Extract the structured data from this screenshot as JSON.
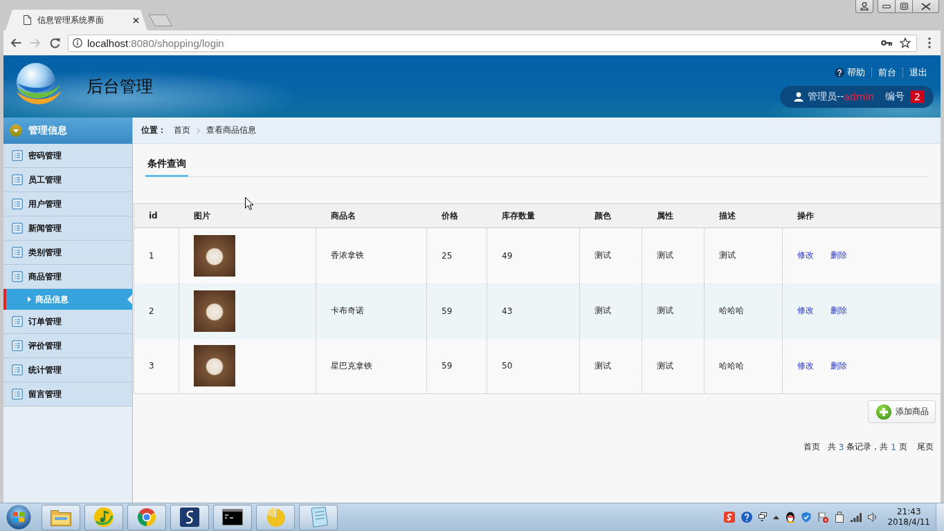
{
  "browser": {
    "tabs": [
      {
        "title": "信息管理系统界面",
        "selected": true
      }
    ],
    "back": {
      "disabled": false
    },
    "forward": {
      "disabled": true
    },
    "url": {
      "host": "localhost",
      "path": ":8080/shopping/login"
    }
  },
  "header": {
    "title": "后台管理",
    "links": [
      {
        "label": "帮助",
        "kind": "help"
      },
      {
        "label": "前台",
        "kind": "plain"
      },
      {
        "label": "退出",
        "kind": "plain"
      }
    ],
    "user": {
      "label": "管理员--",
      "name": "admin",
      "number_label": "编号",
      "number": "2"
    }
  },
  "sidebar": {
    "title": "管理信息",
    "items": [
      {
        "label": "密码管理",
        "selected": false
      },
      {
        "label": "员工管理",
        "selected": false
      },
      {
        "label": "用户管理",
        "selected": false
      },
      {
        "label": "新闻管理",
        "selected": false
      },
      {
        "label": "类别管理",
        "selected": false
      },
      {
        "label": "商品管理",
        "selected": false,
        "children": [
          {
            "label": "商品信息",
            "selected": true
          }
        ]
      },
      {
        "label": "订单管理",
        "selected": false
      },
      {
        "label": "评价管理",
        "selected": false
      },
      {
        "label": "统计管理",
        "selected": false
      },
      {
        "label": "留言管理",
        "selected": false
      }
    ]
  },
  "breadcrumb": {
    "label": "位置：",
    "items": [
      "首页",
      "查看商品信息"
    ]
  },
  "query_tabs": [
    {
      "label": "条件查询",
      "selected": true
    }
  ],
  "table": {
    "columns": [
      "id",
      "图片",
      "商品名",
      "价格",
      "库存数量",
      "颜色",
      "属性",
      "描述",
      "操作"
    ],
    "rows": [
      {
        "id": "1",
        "product_name": "香浓拿铁",
        "price": "25",
        "stock": "49",
        "color_name": "测试",
        "attribute": "测试",
        "description": "测试",
        "actions": [
          "修改",
          "删除"
        ]
      },
      {
        "id": "2",
        "product_name": "卡布奇诺",
        "price": "59",
        "stock": "43",
        "color_name": "测试",
        "attribute": "测试",
        "description": "哈哈哈",
        "actions": [
          "修改",
          "删除"
        ]
      },
      {
        "id": "3",
        "product_name": "星巴克拿铁",
        "price": "59",
        "stock": "50",
        "color_name": "测试",
        "attribute": "测试",
        "description": "哈哈哈",
        "actions": [
          "修改",
          "删除"
        ]
      }
    ]
  },
  "add_button": {
    "label": "添加商品"
  },
  "pagination": {
    "first": "首页",
    "total_label": "共",
    "record_count": "3",
    "records_label": "条记录，共",
    "page_count": "1",
    "pages_label": "页",
    "last": "尾页"
  },
  "taskbar": {
    "time": "21:43",
    "date": "2018/4/11"
  }
}
